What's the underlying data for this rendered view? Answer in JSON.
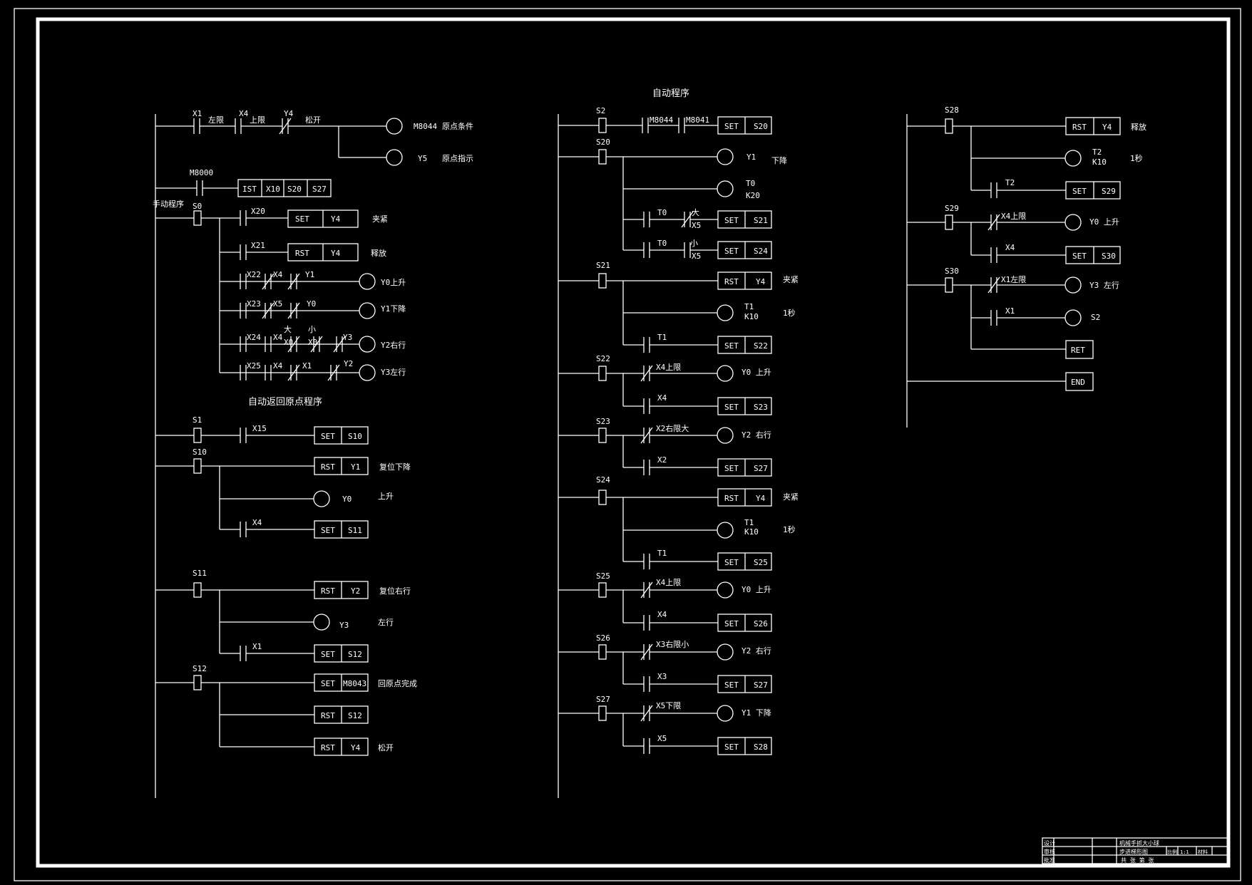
{
  "headings": {
    "auto_program": "自动程序",
    "manual_program": "手动程序",
    "auto_return_origin": "自动返回原点程序"
  },
  "left": {
    "r1": {
      "x1": "X1",
      "x1_note": "左限",
      "x4": "X4",
      "x4_note": "上限",
      "y4": "Y4",
      "y4_note": "松开",
      "m8044": "M8044",
      "m8044_note": "原点条件",
      "y5": "Y5",
      "y5_note": "原点指示"
    },
    "m8000": "M8000",
    "ist": [
      "IST",
      "X10",
      "S20",
      "S27"
    ],
    "s0": "S0",
    "x20": "X20",
    "set_y4": [
      "SET",
      "Y4"
    ],
    "clamp": "夹紧",
    "x21": "X21",
    "rst_y4": [
      "RST",
      "Y4"
    ],
    "release": "释放",
    "r_x22": [
      "X22",
      "X4",
      "Y1"
    ],
    "y0_up": "Y0上升",
    "r_x23": [
      "X23",
      "X5",
      "Y0"
    ],
    "y1_down": "Y1下降",
    "r_x24": [
      "X24",
      "X4",
      "大",
      "X0",
      "小",
      "X0",
      "Y3"
    ],
    "y2_right": "Y2右行",
    "r_x25": [
      "X25",
      "X4",
      "X1",
      "Y2"
    ],
    "y3_left": "Y3左行",
    "s1": "S1",
    "x15": "X15",
    "set_s10": [
      "SET",
      "S10"
    ],
    "s10": "S10",
    "rst_y1": [
      "RST",
      "Y1"
    ],
    "rst_y1_note": "复位下降",
    "y0": "Y0",
    "y0_note": "上升",
    "x4b": "X4",
    "set_s11": [
      "SET",
      "S11"
    ],
    "s11": "S11",
    "rst_y2": [
      "RST",
      "Y2"
    ],
    "rst_y2_note": "复位右行",
    "y3": "Y3",
    "y3_note": "左行",
    "x1b": "X1",
    "set_s12": [
      "SET",
      "S12"
    ],
    "s12": "S12",
    "set_m8043": [
      "SET",
      "M8043"
    ],
    "m8043_note": "回原点完成",
    "rst_s12": [
      "RST",
      "S12"
    ],
    "rst_y4b": [
      "RST",
      "Y4"
    ],
    "rst_y4b_note": "松开"
  },
  "middle": {
    "s2": "S2",
    "m8044": "M8044",
    "m8041": "M8041",
    "set_s20": [
      "SET",
      "S20"
    ],
    "s20": "S20",
    "y1": "Y1",
    "y1_note": "下降",
    "t0": "T0",
    "k20": "K20",
    "t0a": "T0",
    "big": "大",
    "x5a": "X5",
    "set_s21": [
      "SET",
      "S21"
    ],
    "t0b": "T0",
    "small": "小",
    "x5b": "X5",
    "set_s24": [
      "SET",
      "S24"
    ],
    "s21": "S21",
    "rst_y4": [
      "RST",
      "Y4"
    ],
    "clamp": "夹紧",
    "t1": "T1",
    "k10": "K10",
    "wait": "1秒",
    "t1c": "T1",
    "set_s22": [
      "SET",
      "S22"
    ],
    "s22": "S22",
    "x4_upper": "X4上限",
    "y0_up": "Y0 上升",
    "x4": "X4",
    "set_s23": [
      "SET",
      "S23"
    ],
    "s23": "S23",
    "x2_right_big": "X2右限大",
    "y2_right": "Y2 右行",
    "x2": "X2",
    "set_s27a": [
      "SET",
      "S27"
    ],
    "s24": "S24",
    "rst_y4b": [
      "RST",
      "Y4"
    ],
    "clamp_b": "夹紧",
    "t1b": "T1",
    "k10b": "K10",
    "wait_b": "1秒",
    "t1d": "T1",
    "set_s25": [
      "SET",
      "S25"
    ],
    "s25": "S25",
    "x4_upper_b": "X4上限",
    "y0_up_b": "Y0 上升",
    "x4b": "X4",
    "set_s26": [
      "SET",
      "S26"
    ],
    "s26": "S26",
    "x3_right_small": "X3右限小",
    "y2_right_b": "Y2 右行",
    "x3": "X3",
    "set_s27b": [
      "SET",
      "S27"
    ],
    "s27": "S27",
    "x5_lower": "X5下限",
    "y1_down": "Y1 下降",
    "x5": "X5",
    "set_s28": [
      "SET",
      "S28"
    ]
  },
  "right": {
    "s28": "S28",
    "rst_y4": [
      "RST",
      "Y4"
    ],
    "release": "释放",
    "t2": "T2",
    "k10": "K10",
    "wait": "1秒",
    "t2c": "T2",
    "set_s29": [
      "SET",
      "S29"
    ],
    "s29": "S29",
    "x4_upper": "X4上限",
    "y0_up": "Y0 上升",
    "x4": "X4",
    "set_s30": [
      "SET",
      "S30"
    ],
    "s30": "S30",
    "x1_left": "X1左限",
    "y3_left": "Y3 左行",
    "x1": "X1",
    "s2": "S2",
    "ret": "RET",
    "end": "END"
  },
  "title_block": {
    "design": "设计",
    "check": "审核",
    "approve": "批准",
    "title_line1": "机械手抓大小球",
    "title_line2": "步进梯形图",
    "sheet_info": "共  张  第  张",
    "scale_label": "比例",
    "scale_value": "1:1",
    "material_label": "材料"
  }
}
